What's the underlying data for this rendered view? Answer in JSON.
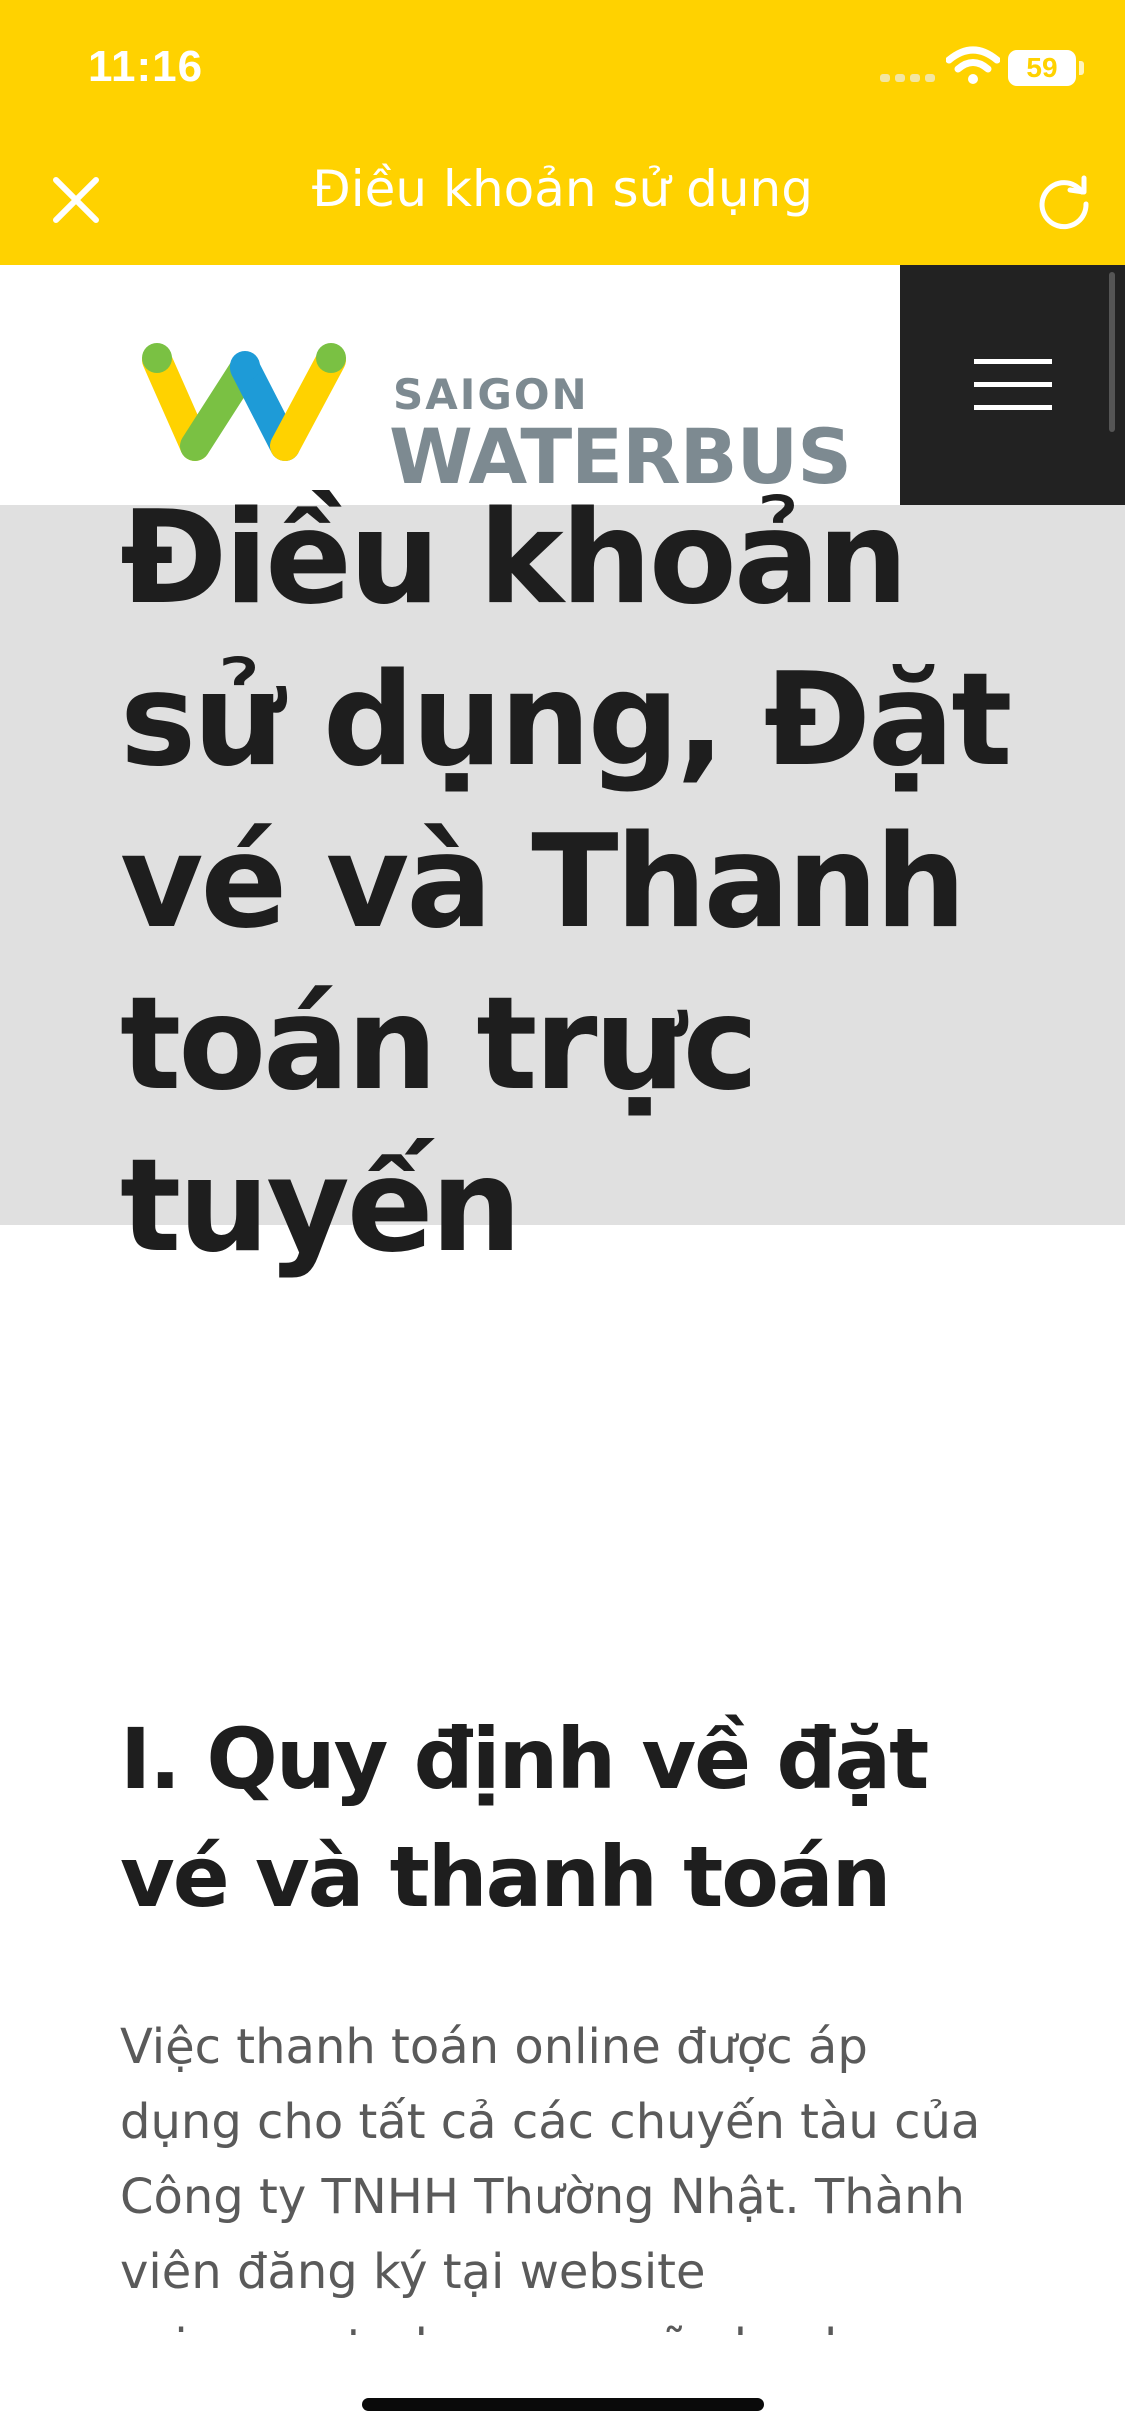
{
  "status_bar": {
    "time": "11:16",
    "battery": "59"
  },
  "app_bar": {
    "title": "Điều khoản sử dụng",
    "background": "#FFD200"
  },
  "site": {
    "logo_top": "SAIGON",
    "logo_bottom": "WATERBUS"
  },
  "hero": {
    "title": "Điều khoản sử dụng, Đặt vé và Thanh toán trực tuyến"
  },
  "content": {
    "section_heading": "I. Quy định về đặt vé và thanh toán",
    "body": "Việc thanh toán online được áp dụng cho tất cả các chuyến tàu của Công ty TNHH Thường Nhật. Thành viên đăng ký tại website saigonwaterbus.com sẽ nhanh chóng"
  },
  "icons": [
    "close-icon",
    "reload-icon",
    "hamburger-menu-icon",
    "wifi-icon",
    "battery-icon"
  ]
}
